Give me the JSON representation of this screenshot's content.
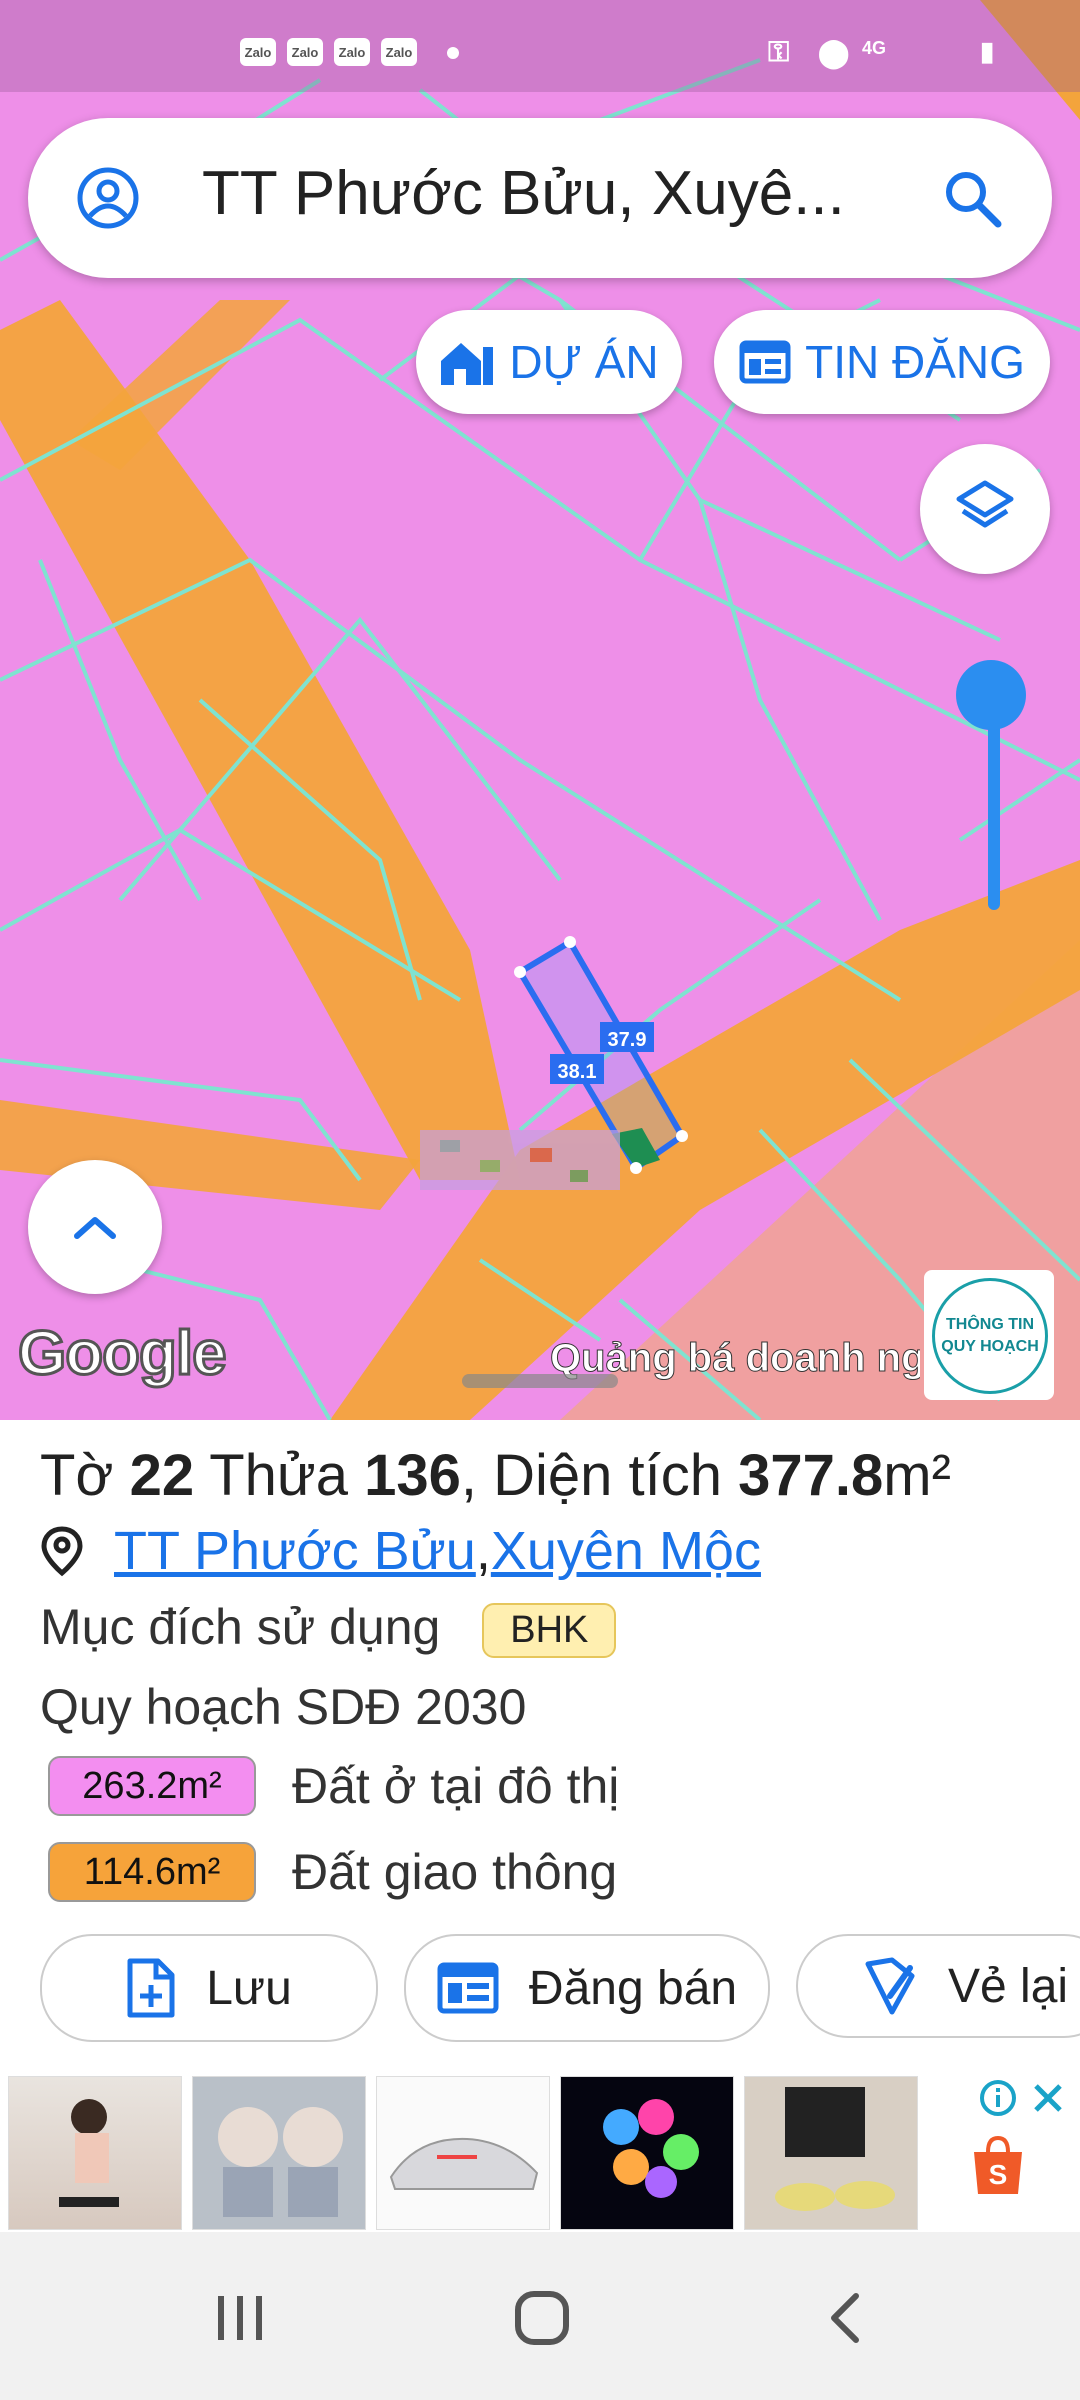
{
  "status_bar": {
    "zalo_label": "Zalo",
    "network": "4G"
  },
  "search": {
    "query": "TT Phước Bửu, Xuyê..."
  },
  "map_buttons": {
    "du_an": "DỰ ÁN",
    "tin_dang": "TIN ĐĂNG"
  },
  "map": {
    "edge_a": "38.1",
    "edge_b": "37.9",
    "google_logo": "Google",
    "ad_overlay": "Quảng bá doanh nghiệp",
    "planning_badge_line1": "THÔNG TIN",
    "planning_badge_line2": "QUY HOẠCH"
  },
  "parcel": {
    "sheet_label": "Tờ",
    "sheet_no": "22",
    "plot_label": "Thửa",
    "plot_no": "136",
    "area_label": "Diện tích",
    "area_value": "377.8",
    "area_unit": "m²",
    "ward": "TT Phước Bửu",
    "district": "Xuyên Mộc",
    "usage_label": "Mục đích sử dụng",
    "usage_code": "BHK",
    "plan_label": "Quy hoạch SDĐ 2030",
    "zones": [
      {
        "area": "263.2m²",
        "label": "Đất ở tại đô thị",
        "color": "#f38ef0"
      },
      {
        "area": "114.6m²",
        "label": "Đất giao thông",
        "color": "#f6a33a"
      }
    ]
  },
  "actions": {
    "save": "Lưu",
    "post": "Đăng bán",
    "redraw": "Vẻ lại"
  },
  "colors": {
    "accent": "#1a73e8",
    "residential_zone": "#ee8fe8",
    "road_zone": "#f3a43c",
    "parcel_lines": "#7fe3d0"
  }
}
